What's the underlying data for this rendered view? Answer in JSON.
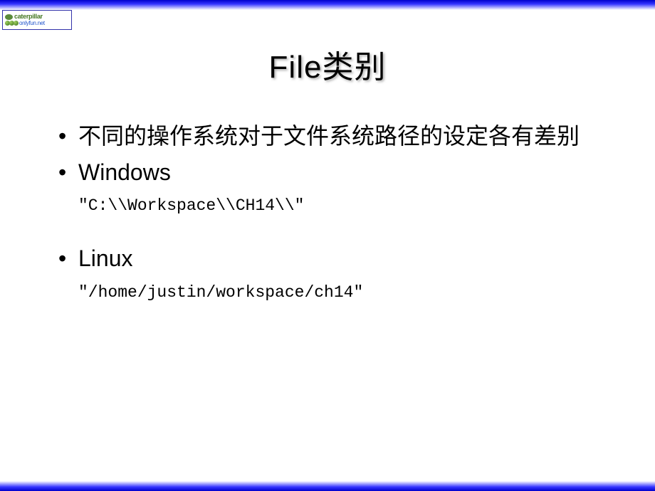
{
  "logo": {
    "text_main": "caterpillar",
    "text_sub": "onlyfun.net"
  },
  "slide": {
    "title": "File类别",
    "bullets": [
      {
        "text": "不同的操作系统对于文件系统路径的设定各有差别",
        "code": null
      },
      {
        "text": "Windows",
        "code": "\"C:\\\\Workspace\\\\CH14\\\\\""
      },
      {
        "text": "Linux",
        "code": "\"/home/justin/workspace/ch14\""
      }
    ]
  }
}
